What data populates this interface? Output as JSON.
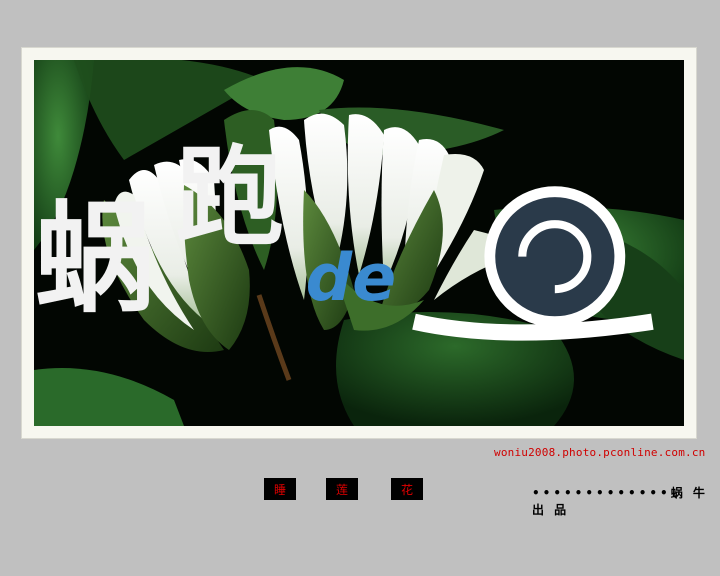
{
  "photo": {
    "subject": "two white water lilies among green lily pads",
    "watermark_text": "蜗跑de"
  },
  "site_url": "woniu2008.photo.pconline.com.cn",
  "title_chars": [
    "睡",
    "莲",
    "花"
  ],
  "credit": "•••••••••••••蜗 牛 出 品",
  "colors": {
    "background": "#c0c0c0",
    "frame": "#f7f7f0",
    "title_box": "#000000",
    "title_text": "#e00000",
    "url_text": "#d00000"
  }
}
